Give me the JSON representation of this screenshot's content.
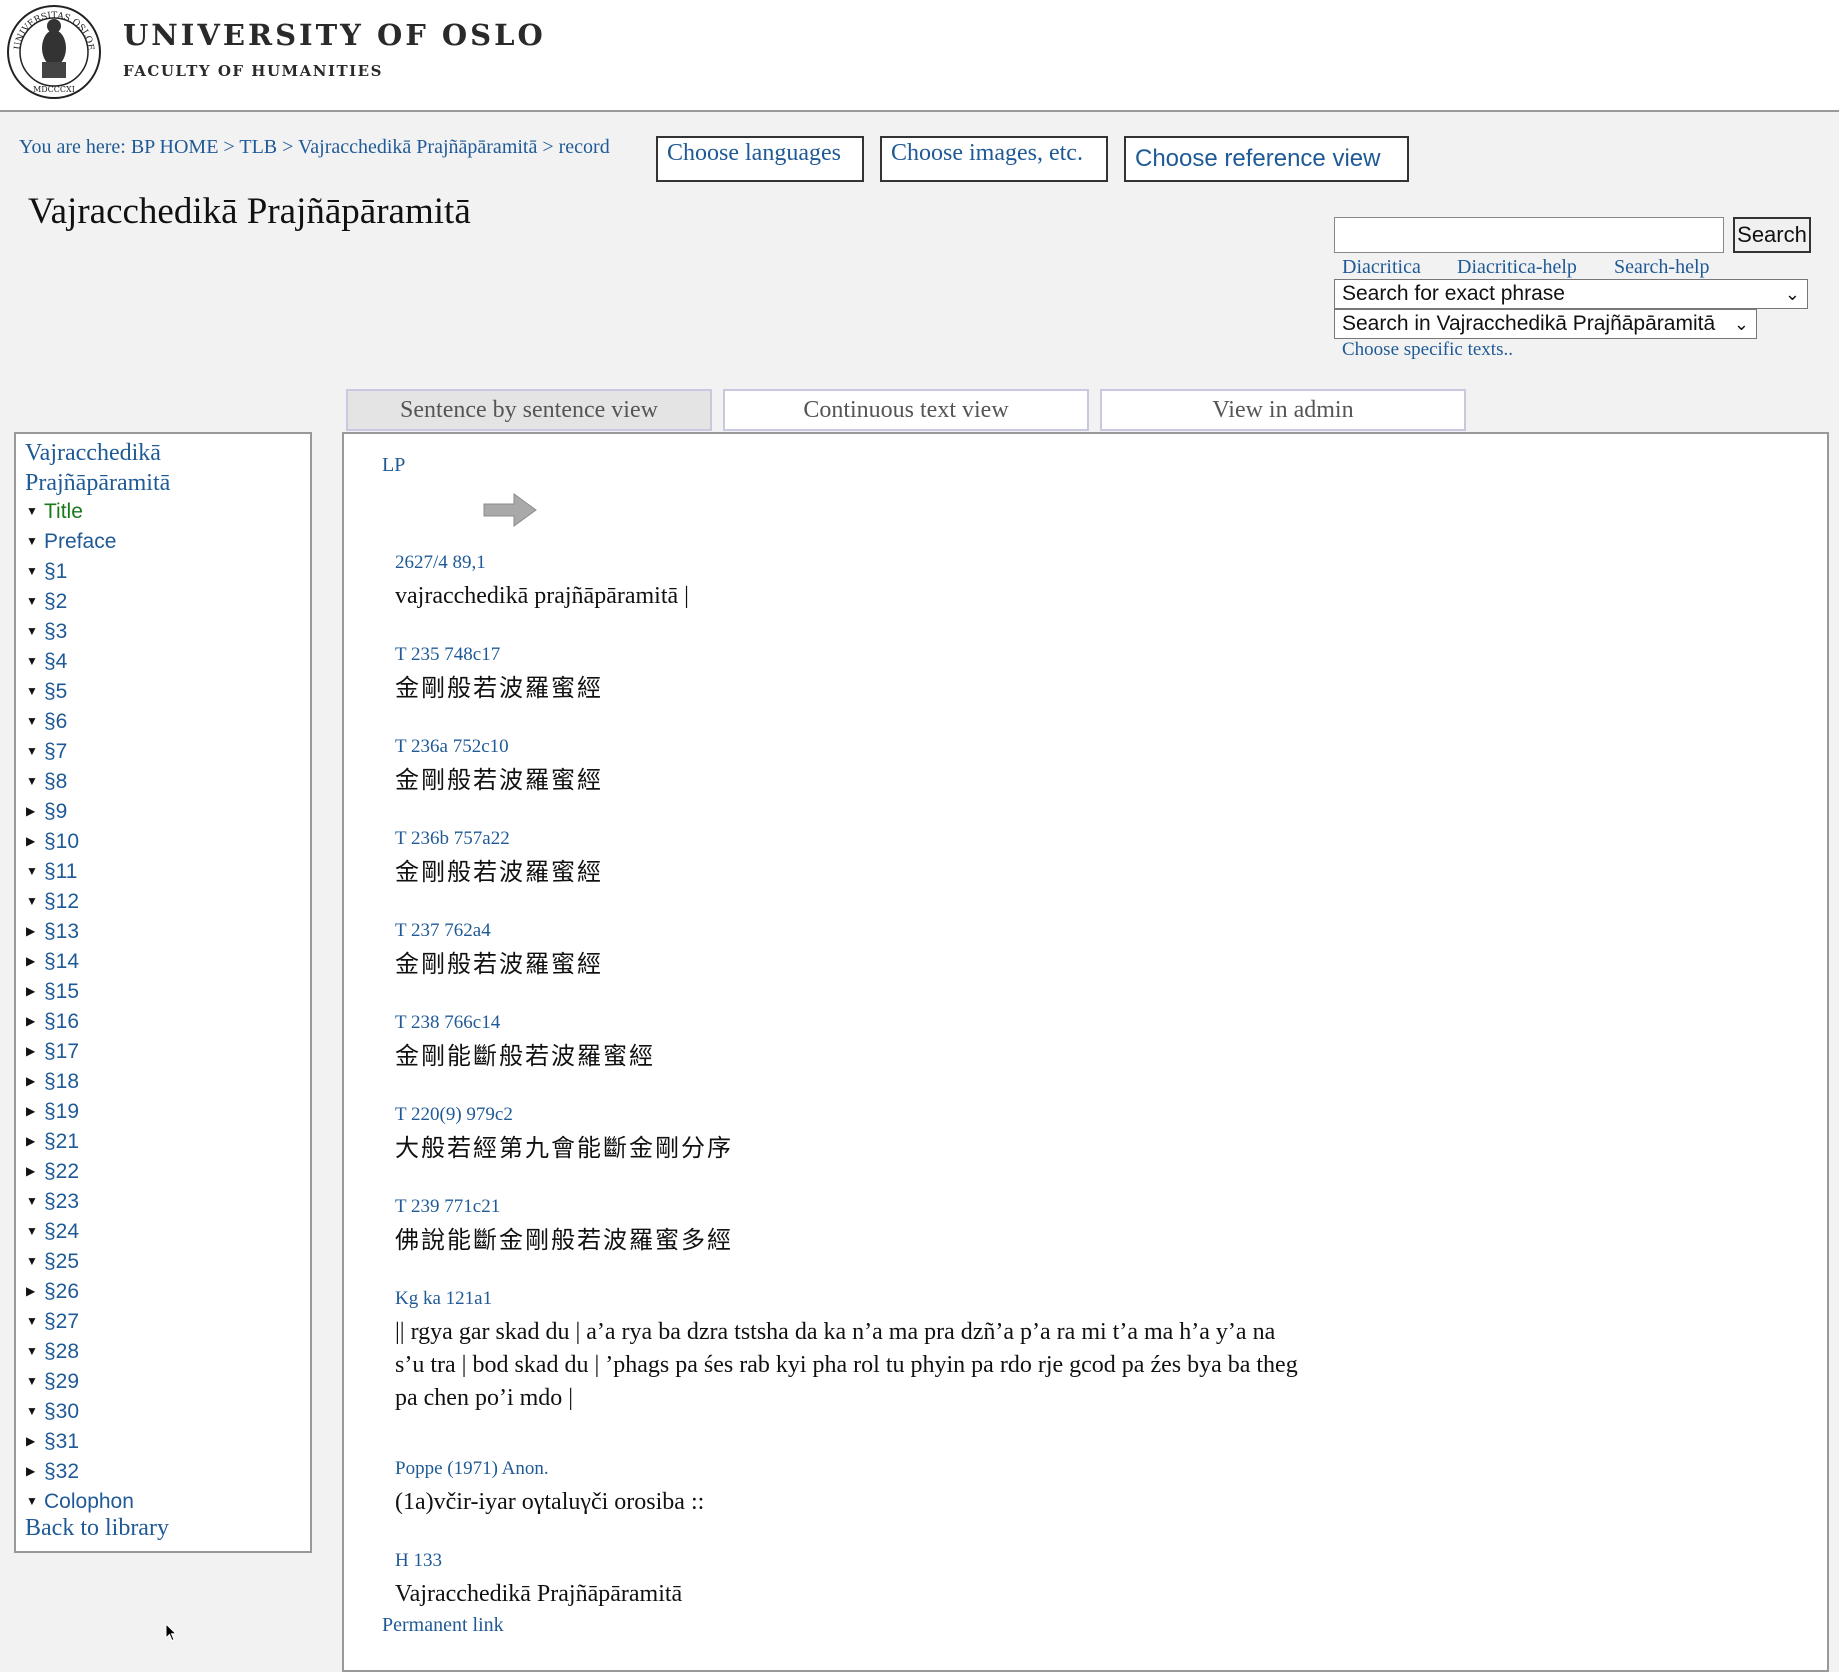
{
  "header": {
    "university": "UNIVERSITY OF OSLO",
    "faculty": "FACULTY OF HUMANITIES",
    "seal_text": "UNIVERSITAS OSLOENSIS MDCCCXI"
  },
  "breadcrumb": "You are here: BP HOME > TLB > Vajracchedikā Prajñāpāramitā > record",
  "buttons": {
    "choose_languages": "Choose languages",
    "choose_images": "Choose images, etc.",
    "choose_reference": "Choose reference view"
  },
  "page_title": "Vajracchedikā Prajñāpāramitā",
  "search": {
    "input_value": "",
    "button_label": "Search",
    "links": [
      "Diacritica",
      "Diacritica-help",
      "Search-help"
    ],
    "mode_selected": "Search for exact phrase",
    "scope_selected": "Search in Vajracchedikā Prajñāpāramitā",
    "choose_specific": "Choose specific texts.."
  },
  "tabs": [
    {
      "label": "Sentence by sentence view",
      "active": true
    },
    {
      "label": "Continuous text view",
      "active": false
    },
    {
      "label": "View in admin",
      "active": false
    }
  ],
  "sidebar": {
    "root_line1": "Vajracchedikā",
    "root_line2": "Prajñāpāramitā",
    "items": [
      {
        "label": "Title",
        "expanded": true,
        "current": true
      },
      {
        "label": "Preface",
        "expanded": true
      },
      {
        "label": "§1",
        "expanded": true
      },
      {
        "label": "§2",
        "expanded": true
      },
      {
        "label": "§3",
        "expanded": true
      },
      {
        "label": "§4",
        "expanded": true
      },
      {
        "label": "§5",
        "expanded": true
      },
      {
        "label": "§6",
        "expanded": true
      },
      {
        "label": "§7",
        "expanded": true
      },
      {
        "label": "§8",
        "expanded": true
      },
      {
        "label": "§9",
        "expanded": false
      },
      {
        "label": "§10",
        "expanded": false
      },
      {
        "label": "§11",
        "expanded": true
      },
      {
        "label": "§12",
        "expanded": true
      },
      {
        "label": "§13",
        "expanded": false
      },
      {
        "label": "§14",
        "expanded": false
      },
      {
        "label": "§15",
        "expanded": false
      },
      {
        "label": "§16",
        "expanded": false
      },
      {
        "label": "§17",
        "expanded": false
      },
      {
        "label": "§18",
        "expanded": false
      },
      {
        "label": "§19",
        "expanded": false
      },
      {
        "label": "§21",
        "expanded": false
      },
      {
        "label": "§22",
        "expanded": false
      },
      {
        "label": "§23",
        "expanded": true
      },
      {
        "label": "§24",
        "expanded": true
      },
      {
        "label": "§25",
        "expanded": true
      },
      {
        "label": "§26",
        "expanded": false
      },
      {
        "label": "§27",
        "expanded": true
      },
      {
        "label": "§28",
        "expanded": true
      },
      {
        "label": "§29",
        "expanded": true
      },
      {
        "label": "§30",
        "expanded": true
      },
      {
        "label": "§31",
        "expanded": false
      },
      {
        "label": "§32",
        "expanded": false
      },
      {
        "label": "Colophon",
        "expanded": true
      }
    ],
    "back_to_library": "Back to library"
  },
  "main": {
    "lp_label": "LP",
    "entries": [
      {
        "ref": "2627/4 89,1",
        "lines": [
          "vajracchedikā prajñāpāramitā |"
        ],
        "cjk": false
      },
      {
        "ref": "T 235 748c17",
        "lines": [
          "金剛般若波羅蜜經"
        ],
        "cjk": true
      },
      {
        "ref": "T 236a 752c10",
        "lines": [
          "金剛般若波羅蜜經"
        ],
        "cjk": true
      },
      {
        "ref": "T 236b 757a22",
        "lines": [
          "金剛般若波羅蜜經"
        ],
        "cjk": true
      },
      {
        "ref": "T 237 762a4",
        "lines": [
          "金剛般若波羅蜜經"
        ],
        "cjk": true
      },
      {
        "ref": "T 238 766c14",
        "lines": [
          "金剛能斷般若波羅蜜經"
        ],
        "cjk": true
      },
      {
        "ref": "T 220(9) 979c2",
        "lines": [
          "大般若經第九會能斷金剛分序"
        ],
        "cjk": true
      },
      {
        "ref": "T 239 771c21",
        "lines": [
          "佛說能斷金剛般若波羅蜜多經"
        ],
        "cjk": true
      },
      {
        "ref": "Kg ka 121a1",
        "lines": [
          "|| rgya gar skad du | a’a rya ba dzra tstsha da ka n’a ma pra dzñ’a p’a ra mi t’a ma h’a y’a na",
          "s’u tra | bod skad du | ’phags pa śes rab kyi pha rol tu phyin pa rdo rje gcod pa źes bya ba theg",
          "pa chen po’i mdo |"
        ],
        "cjk": false
      },
      {
        "ref": "Poppe (1971) Anon.",
        "lines": [
          "(1a)včir-iyar oγtaluγči orosiba ::"
        ],
        "cjk": false
      },
      {
        "ref": "H 133",
        "lines": [
          "Vajracchedikā Prajñāpāramitā"
        ],
        "cjk": false
      }
    ],
    "permanent_link": "Permanent link"
  }
}
